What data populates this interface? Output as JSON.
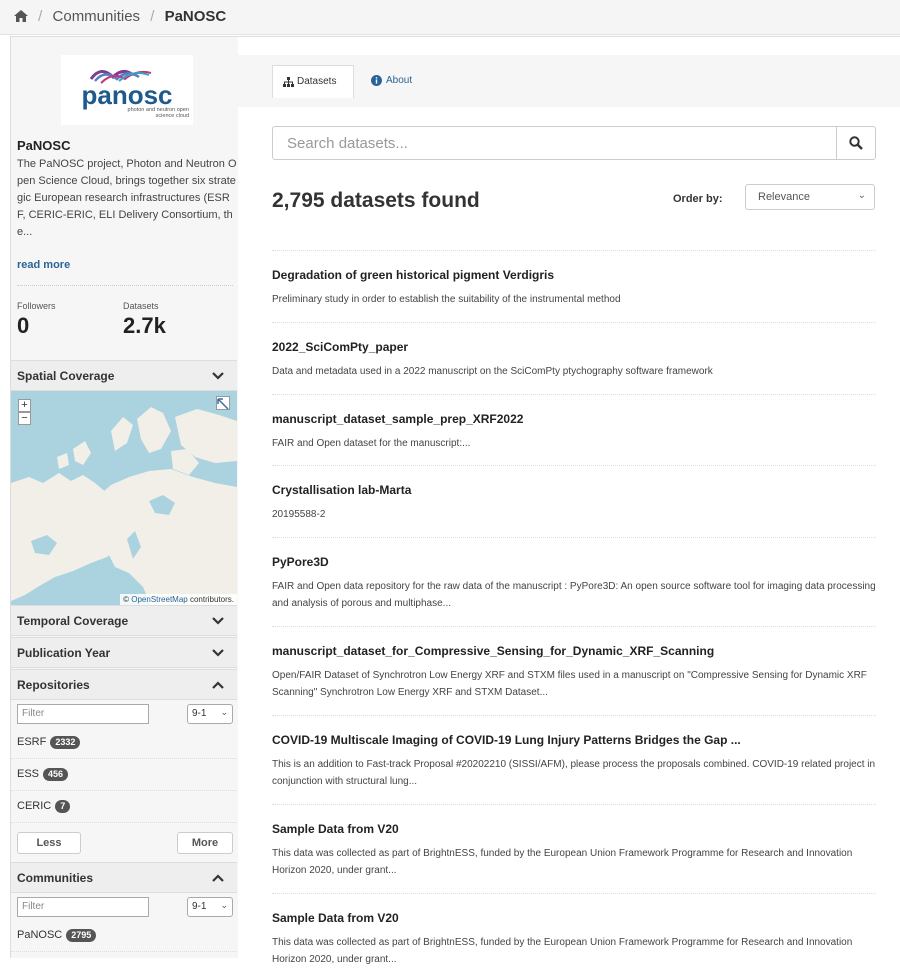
{
  "breadcrumb": {
    "home_icon": "home-icon",
    "items": [
      "Communities",
      "PaNOSC"
    ]
  },
  "org": {
    "logo_text": "panosc",
    "logo_tagline": "photon and neutron open science cloud",
    "title": "PaNOSC",
    "description": "The PaNOSC project, Photon and Neutron Open Science Cloud, brings together six strategic European research infrastructures (ESRF, CERIC-ERIC, ELI Delivery Consortium, the...",
    "read_more": "read more",
    "followers_label": "Followers",
    "followers_value": "0",
    "datasets_label": "Datasets",
    "datasets_value": "2.7k"
  },
  "facets": {
    "spatial": "Spatial Coverage",
    "temporal": "Temporal Coverage",
    "pubyear": "Publication Year",
    "repositories": "Repositories",
    "communities": "Communities"
  },
  "map": {
    "zoom_in": "+",
    "zoom_out": "−",
    "attribution_prefix": "©",
    "attribution_link": "OpenStreetMap",
    "attribution_suffix": "contributors."
  },
  "repositories": {
    "filter_placeholder": "Filter",
    "sort_value": "9-1",
    "items": [
      {
        "name": "ESRF",
        "count": "2332"
      },
      {
        "name": "ESS",
        "count": "456"
      },
      {
        "name": "CERIC",
        "count": "7"
      }
    ],
    "less_label": "Less",
    "more_label": "More"
  },
  "communities": {
    "filter_placeholder": "Filter",
    "sort_value": "9-1",
    "items": [
      {
        "name": "PaNOSC",
        "count": "2795"
      }
    ]
  },
  "tabs": {
    "datasets": "Datasets",
    "about": "About"
  },
  "search": {
    "placeholder": "Search datasets..."
  },
  "results": {
    "count_text": "2,795 datasets found",
    "order_label": "Order by:",
    "order_value": "Relevance",
    "datasets": [
      {
        "title": "Degradation of green historical pigment Verdigris",
        "desc": "Preliminary study in order to establish the suitability of the instrumental method"
      },
      {
        "title": "2022_SciComPty_paper",
        "desc": "Data and metadata used in a 2022 manuscript on the SciComPty ptychography software framework"
      },
      {
        "title": "manuscript_dataset_sample_prep_XRF2022",
        "desc": "FAIR and Open dataset for the manuscript:..."
      },
      {
        "title": "Crystallisation lab-Marta",
        "desc": "20195588-2"
      },
      {
        "title": "PyPore3D",
        "desc": "FAIR and Open data repository for the raw data of the manuscript : PyPore3D: An open source software tool for imaging data processing and analysis of porous and multiphase..."
      },
      {
        "title": "manuscript_dataset_for_Compressive_Sensing_for_Dynamic_XRF_Scanning",
        "desc": "Open/FAIR Dataset of Synchrotron Low Energy XRF and STXM files used in a manuscript on \"Compressive Sensing for Dynamic XRF Scanning\" Synchrotron Low Energy XRF and STXM Dataset..."
      },
      {
        "title": "COVID-19 Multiscale Imaging of COVID-19 Lung Injury Patterns Bridges the Gap ...",
        "desc": "This is an addition to Fast-track Proposal #20202210 (SISSI/AFM), please process the proposals combined. COVID-19 related project in conjunction with structural lung..."
      },
      {
        "title": "Sample Data from V20",
        "desc": "This data was collected as part of BrightnESS, funded by the European Union Framework Programme for Research and Innovation Horizon 2020, under grant..."
      },
      {
        "title": "Sample Data from V20",
        "desc": "This data was collected as part of BrightnESS, funded by the European Union Framework Programme for Research and Innovation Horizon 2020, under grant..."
      }
    ]
  }
}
